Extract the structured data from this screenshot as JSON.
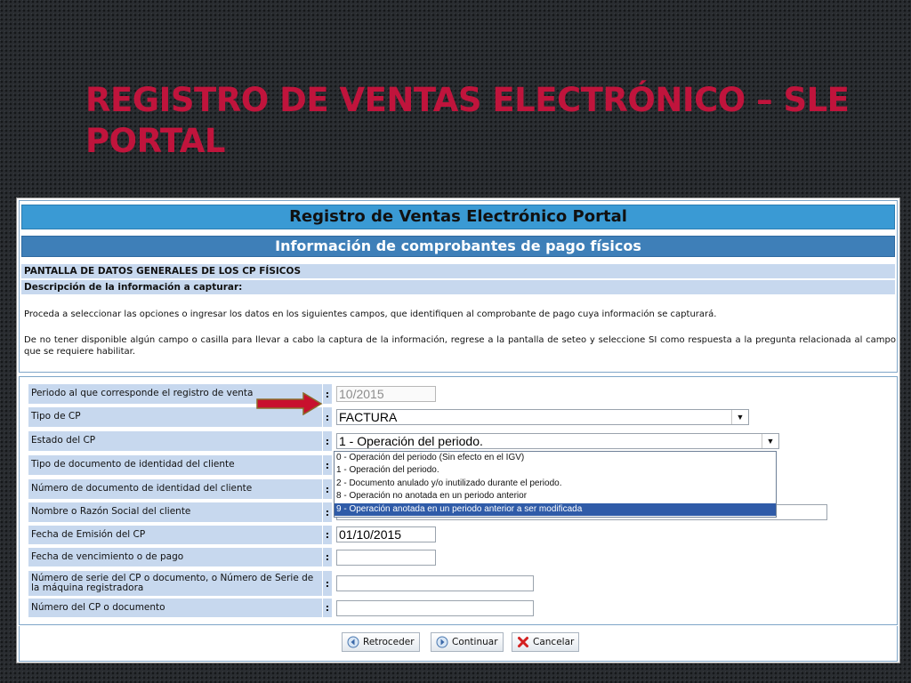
{
  "slide": {
    "title_line1": "REGISTRO DE VENTAS ELECTRÓNICO – SLE",
    "title_line2": "PORTAL"
  },
  "app": {
    "header": "Registro de Ventas Electrónico Portal",
    "subheader": "Información de comprobantes de pago físicos",
    "section_title": "PANTALLA DE DATOS GENERALES DE LOS CP FÍSICOS",
    "section_desc": "Descripción de la información a capturar:",
    "paragraph1": "Proceda a seleccionar las opciones o ingresar los datos en los siguientes campos, que identifiquen al comprobante de pago cuya información se capturará.",
    "paragraph2": "De no tener disponible algún campo o casilla para llevar a cabo la captura de la información, regrese a la pantalla de seteo y seleccione SI como respuesta a la pregunta relacionada al campo que se requiere habilitar."
  },
  "form": {
    "colon": ":",
    "periodo": {
      "label": "Periodo al que corresponde el registro de venta",
      "value": "10/2015"
    },
    "tipo_cp": {
      "label": "Tipo de CP",
      "value": "FACTURA"
    },
    "estado_cp": {
      "label": "Estado del CP",
      "value": "1 - Operación del periodo.",
      "options": [
        "0 - Operación del periodo (Sin efecto en el IGV)",
        "1 - Operación del periodo.",
        "2 - Documento anulado y/o inutilizado durante el periodo.",
        "8 - Operación no anotada en un periodo anterior",
        "9 - Operación anotada en un periodo anterior a ser modificada"
      ],
      "highlighted_option": "9 - Operación anotada en un periodo anterior a ser modificada"
    },
    "tipo_doc": {
      "label": "Tipo de documento de identidad del cliente"
    },
    "num_doc": {
      "label": "Número de documento de identidad del cliente"
    },
    "razon_social": {
      "label": "Nombre o Razón Social del cliente",
      "value": ""
    },
    "fecha_emision": {
      "label": "Fecha de Emisión del CP",
      "value": "01/10/2015"
    },
    "fecha_venc": {
      "label": "Fecha de vencimiento o de pago",
      "value": ""
    },
    "num_serie": {
      "label": "Número de serie del CP o documento, o Número de Serie de la máquina registradora",
      "value": ""
    },
    "num_cp": {
      "label": "Número del CP o documento",
      "value": ""
    }
  },
  "buttons": {
    "back": "Retroceder",
    "next": "Continuar",
    "cancel": "Cancelar"
  },
  "colors": {
    "title": "#c0143c",
    "banner_main": "#3a9ad4",
    "banner_sub": "#3e7fb8",
    "label_bg": "#c7d8ee",
    "selected_option": "#2f5ba8",
    "arrow": "#c8102e"
  },
  "icons": {
    "back": "circle-arrow-left-icon",
    "next": "circle-arrow-right-icon",
    "cancel": "red-x-icon",
    "dropdown": "chevron-down-icon"
  }
}
